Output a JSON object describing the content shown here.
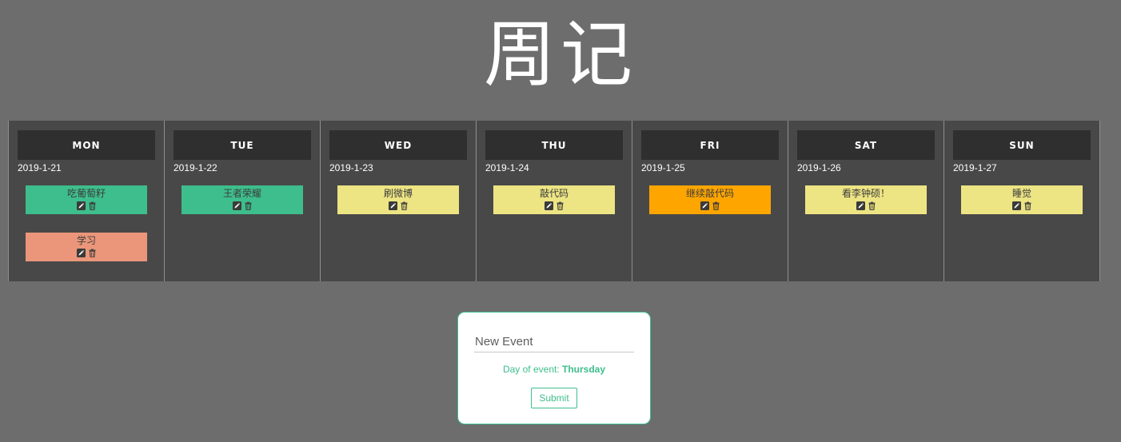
{
  "page": {
    "title": "周记"
  },
  "week": {
    "days": [
      {
        "name": "MON",
        "date": "2019-1-21",
        "events": [
          {
            "title": "吃葡萄籽",
            "color": "#3dbe8c"
          },
          {
            "title": "学习",
            "color": "#eb967a"
          }
        ]
      },
      {
        "name": "TUE",
        "date": "2019-1-22",
        "events": [
          {
            "title": "王者荣耀",
            "color": "#3dbe8c"
          }
        ]
      },
      {
        "name": "WED",
        "date": "2019-1-23",
        "events": [
          {
            "title": "刷微博",
            "color": "#ede483"
          }
        ]
      },
      {
        "name": "THU",
        "date": "2019-1-24",
        "events": [
          {
            "title": "敲代码",
            "color": "#ede483"
          }
        ]
      },
      {
        "name": "FRI",
        "date": "2019-1-25",
        "events": [
          {
            "title": "继续敲代码",
            "color": "#ffa500"
          }
        ]
      },
      {
        "name": "SAT",
        "date": "2019-1-26",
        "events": [
          {
            "title": "看李钟硕！",
            "color": "#ede483"
          }
        ]
      },
      {
        "name": "SUN",
        "date": "2019-1-27",
        "events": [
          {
            "title": "睡觉",
            "color": "#ede483"
          }
        ]
      }
    ]
  },
  "event_icons": {
    "edit": "pencil-icon",
    "delete": "trash-icon"
  },
  "form": {
    "placeholder": "New Event",
    "value": "",
    "day_label": "Day of event:",
    "day_value": "Thursday",
    "submit_label": "Submit",
    "accent_color": "#3dbe8c"
  }
}
